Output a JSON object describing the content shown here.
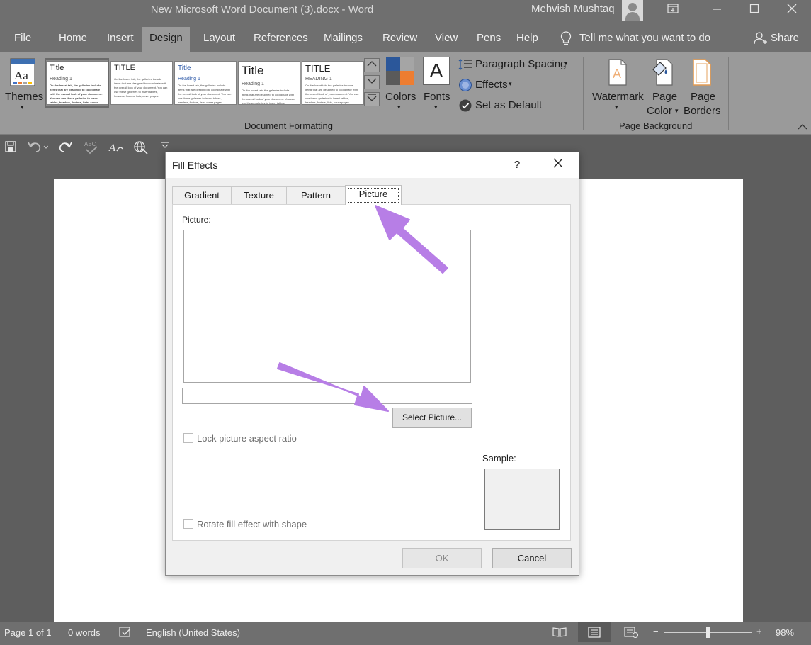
{
  "window": {
    "title": "New Microsoft Word Document (3).docx  -  Word",
    "user": "Mehvish Mushtaq"
  },
  "ribbon_tabs": [
    "File",
    "Home",
    "Insert",
    "Design",
    "Layout",
    "References",
    "Mailings",
    "Review",
    "View",
    "Pens",
    "Help"
  ],
  "tell_me": "Tell me what you want to do",
  "share": "Share",
  "ribbon": {
    "themes": "Themes",
    "style_gallery": [
      {
        "title": "Title",
        "heading": "Heading 1"
      },
      {
        "title": "TITLE",
        "heading": ""
      },
      {
        "title": "Title",
        "heading": "Heading 1"
      },
      {
        "title": "Title",
        "heading": "Heading 1"
      },
      {
        "title": "TITLE",
        "heading": "HEADING 1"
      }
    ],
    "gallery_body_text": "On the Insert tab, the galleries include items that are designed to coordinate with the overall look of your document. You can use these galleries to insert tables, headers, footers, lists, cover pages.",
    "colors": "Colors",
    "fonts": "Fonts",
    "fonts_glyph": "A",
    "paragraph_spacing": "Paragraph Spacing",
    "effects": "Effects",
    "set_as_default": "Set as Default",
    "document_formatting": "Document Formatting",
    "watermark": "Watermark",
    "page_color_1": "Page",
    "page_color_2": "Color",
    "page_borders_1": "Page",
    "page_borders_2": "Borders",
    "page_background": "Page Background",
    "color_swatches": [
      "#2b579a",
      "#a5a5a5",
      "#ed7d31",
      "#5a5a5a"
    ]
  },
  "dialog": {
    "title": "Fill Effects",
    "help": "?",
    "tabs": [
      "Gradient",
      "Texture",
      "Pattern",
      "Picture"
    ],
    "active_tab": "Picture",
    "picture_label": "Picture:",
    "select_picture": "Select Picture...",
    "lock_aspect": "Lock picture aspect ratio",
    "rotate_fill": "Rotate fill effect with shape",
    "sample_label": "Sample:",
    "ok": "OK",
    "cancel": "Cancel"
  },
  "status": {
    "page": "Page 1 of 1",
    "words": "0 words",
    "language": "English (United States)",
    "zoom": "98%",
    "zoom_out": "−",
    "zoom_in": "+"
  },
  "colors": {
    "annotation_arrow": "#b77ee6"
  }
}
